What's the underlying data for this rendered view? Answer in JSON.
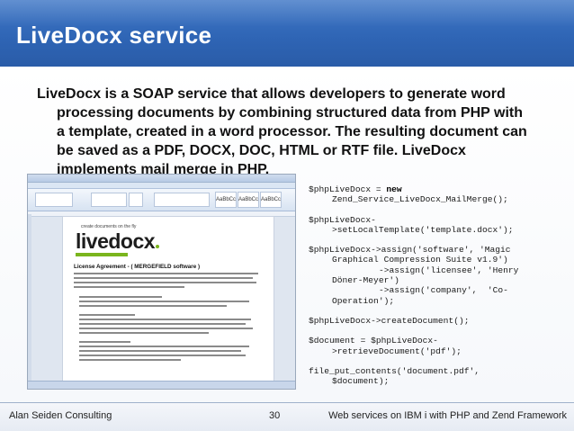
{
  "slide": {
    "title": "LiveDocx service",
    "bullet": {
      "line1": "LiveDocx is a SOAP service that allows developers to generate word",
      "rest": "processing documents by combining structured data from PHP with a template, created in a word processor. The resulting document can be saved as a PDF, DOCX, DOC, HTML or RTF file. LiveDocx implements mail merge in PHP."
    },
    "screenshot": {
      "logo_tagline": "create documents on the fly",
      "logo_text": "livedocx",
      "license_heading": "License Agreement - ( MERGEFIELD software )",
      "style_boxes": [
        "AaBbCc",
        "AaBbCc",
        "AaBbCc"
      ]
    },
    "code": [
      [
        "$phpLiveDocx = new",
        "Zend_Service_LiveDocx_MailMerge();"
      ],
      [
        "$phpLiveDocx-",
        ">setLocalTemplate('template.docx');"
      ],
      [
        "$phpLiveDocx->assign('software', 'Magic",
        "Graphical Compression Suite v1.9')",
        "->assign('licensee', 'Henry",
        "Döner-Meyer')",
        "->assign('company',  'Co-",
        "Operation');"
      ],
      [
        "$phpLiveDocx->createDocument();"
      ],
      [
        "$document = $phpLiveDocx-",
        ">retrieveDocument('pdf');"
      ],
      [
        "file_put_contents('document.pdf',",
        "$document);"
      ]
    ],
    "footer": {
      "left": "Alan Seiden Consulting",
      "page": "30",
      "right": "Web services on IBM i with PHP and Zend Framework"
    }
  }
}
